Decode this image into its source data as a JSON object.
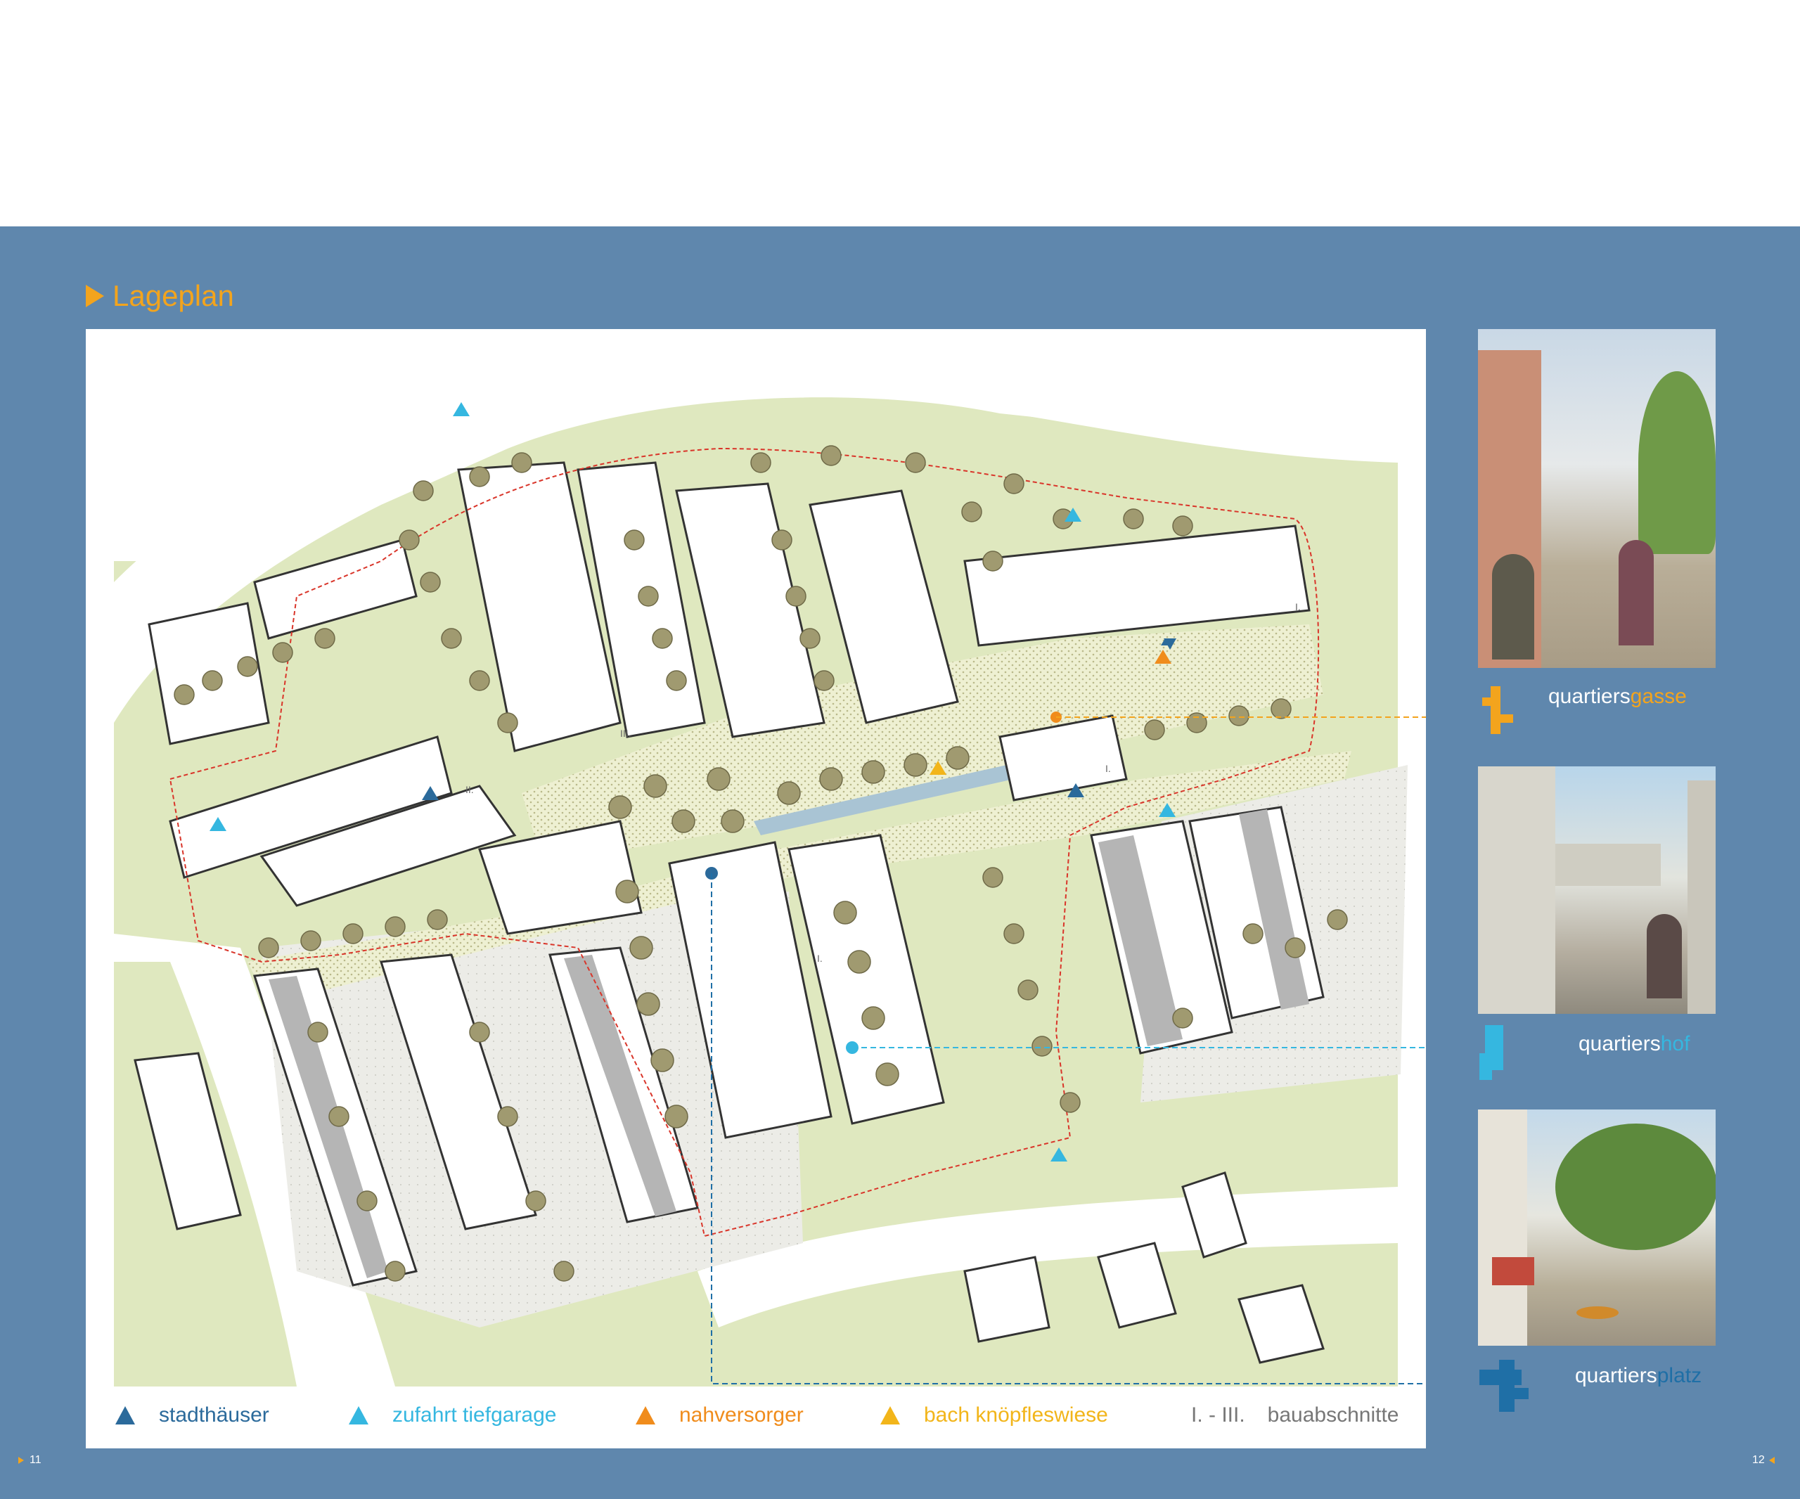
{
  "page": {
    "title": "Lageplan",
    "page_left": "11",
    "page_right": "12"
  },
  "legend": [
    {
      "label": "stadthäuser",
      "color": "#2b6a9b"
    },
    {
      "label": "zufahrt tiefgarage",
      "color": "#35b7e0"
    },
    {
      "label": "nahversorger",
      "color": "#f08c1c"
    },
    {
      "label": "bach knöpfleswiese",
      "color": "#f2b51a"
    },
    {
      "label": "bauabschnitte",
      "prefix": "I. - III.",
      "color": "#777777"
    }
  ],
  "map": {
    "building_phase_labels": [
      "I.",
      "II.",
      "III."
    ]
  },
  "photos": [
    {
      "caption_main": "quartiers",
      "caption_accent": "gasse",
      "accent_color": "#f3a41d",
      "icon": "orange-path-icon"
    },
    {
      "caption_main": "quartiers",
      "caption_accent": "hof",
      "accent_color": "#35b7e0",
      "icon": "cyan-path-icon"
    },
    {
      "caption_main": "quartiers",
      "caption_accent": "platz",
      "accent_color": "#1f6fa6",
      "icon": "blue-path-icon"
    }
  ],
  "colors": {
    "panel": "#5f87ad",
    "accent": "#f3a41d",
    "green": "#dfe8bf",
    "tree": "#a09a70"
  }
}
